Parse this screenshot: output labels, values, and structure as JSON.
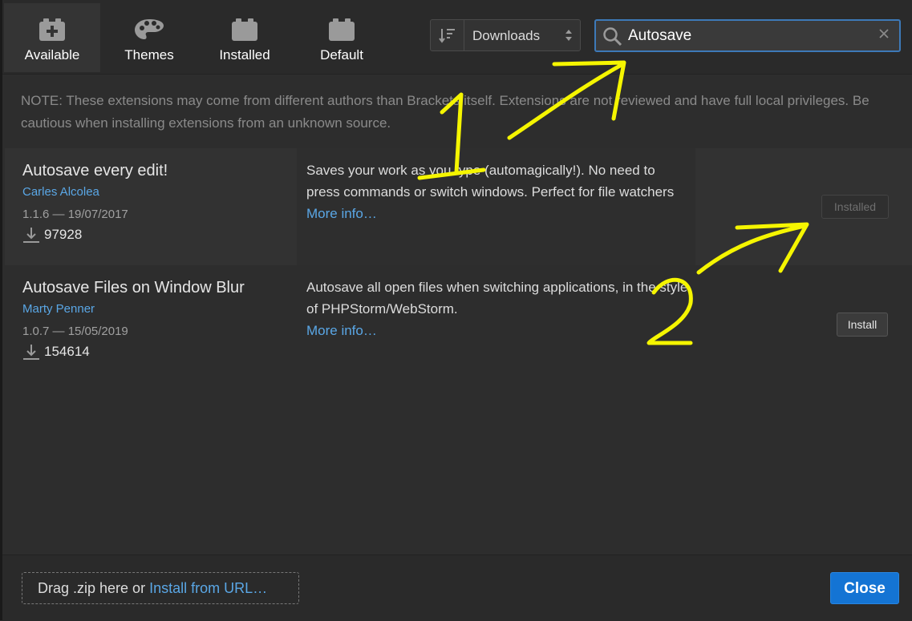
{
  "tabs": [
    {
      "label": "Available",
      "icon": "available-icon",
      "active": true
    },
    {
      "label": "Themes",
      "icon": "palette-icon"
    },
    {
      "label": "Installed",
      "icon": "installed-icon"
    },
    {
      "label": "Default",
      "icon": "default-icon"
    }
  ],
  "sort": {
    "label": "Downloads",
    "icon": "sort-icon"
  },
  "search": {
    "value": "Autosave",
    "icon": "search-icon",
    "clear_icon": "close-icon"
  },
  "note": "NOTE: These extensions may come from different authors than Brackets itself. Extensions are not reviewed and have full local privileges. Be cautious when installing extensions from an unknown source.",
  "extensions": [
    {
      "title": "Autosave every edit!",
      "author": "Carles Alcolea",
      "version_date": "1.1.6 — 19/07/2017",
      "downloads": "97928",
      "description": "Saves your work as you type (automagically!). No need to press commands or switch windows. Perfect for file watchers",
      "more_info": "More info…",
      "button": "Installed"
    },
    {
      "title": "Autosave Files on Window Blur",
      "author": "Marty Penner",
      "version_date": "1.0.7 — 15/05/2019",
      "downloads": "154614",
      "description": "Autosave all open files when switching applications, in the style of PHPStorm/WebStorm.",
      "more_info": "More info…",
      "button": "Install"
    }
  ],
  "footer": {
    "drop_text": "Drag .zip here or ",
    "install_url": "Install from URL…",
    "close": "Close"
  },
  "colors": {
    "background": "#2d2d2d",
    "accent": "#1474d4",
    "link": "#5aa7e6",
    "annotation": "#f5f500"
  },
  "annotations": [
    "1",
    "2"
  ]
}
